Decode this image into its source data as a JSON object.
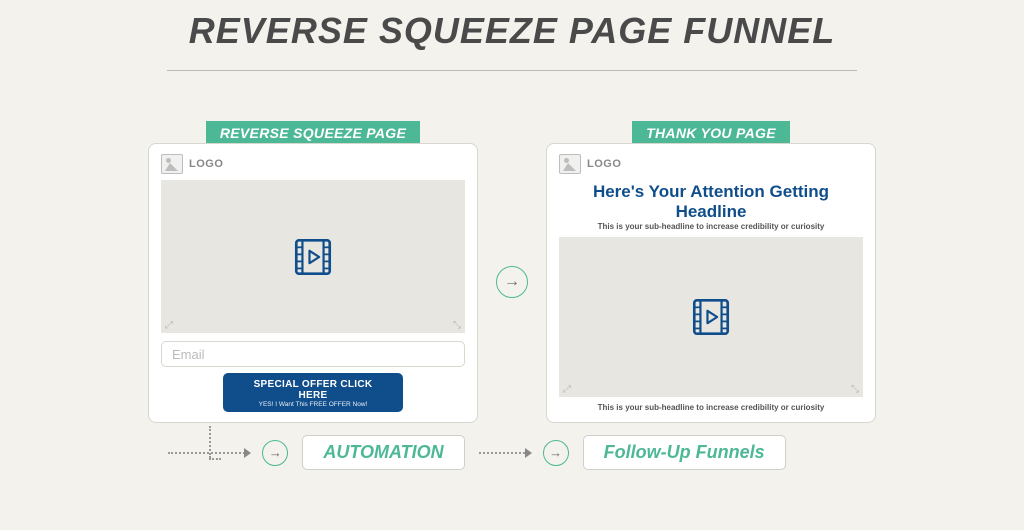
{
  "title": "REVERSE SQUEEZE PAGE FUNNEL",
  "pages": {
    "squeeze": {
      "label": "REVERSE SQUEEZE PAGE",
      "logo_text": "LOGO",
      "email_placeholder": "Email",
      "cta_main": "SPECIAL OFFER CLICK HERE",
      "cta_sub": "YES! I Want This FREE OFFER Now!"
    },
    "thankyou": {
      "label": "THANK YOU PAGE",
      "logo_text": "LOGO",
      "headline": "Here's Your Attention Getting Headline",
      "subheadline": "This is your sub-headline to increase credibility or curiosity",
      "bottom_sub": "This is your sub-headline to increase credibility or curiosity"
    }
  },
  "flow": {
    "automation_label": "AUTOMATION",
    "followup_label": "Follow-Up Funnels"
  },
  "icons": {
    "arrow": "→"
  }
}
